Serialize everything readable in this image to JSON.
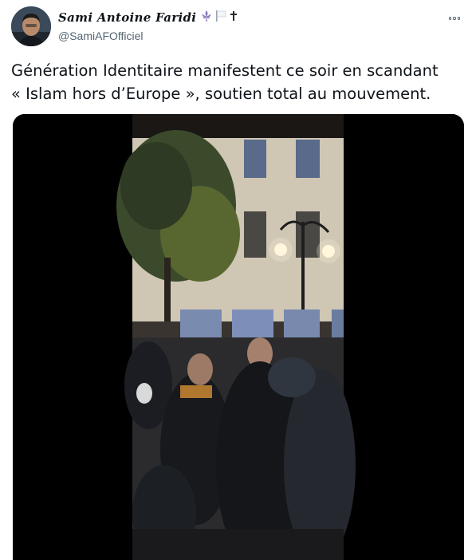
{
  "tweet": {
    "author": {
      "display_name": "Sami Antoine Faridi",
      "handle": "@SamiAFOfficiel",
      "name_emojis": [
        "fleur-de-lis-icon",
        "white-flag-icon",
        "latin-cross-icon"
      ]
    },
    "text_lines": [
      "Génération Identitaire manifestent ce soir en scandant",
      "« Islam hors d’Europe », soutien total au mouvement."
    ],
    "more_icon": "more-options-icon",
    "media": {
      "type": "video",
      "description_icon": "video-still"
    }
  },
  "colors": {
    "text": "#0f1419",
    "secondary_text": "#536471",
    "media_background": "#000000",
    "fleur_de_lis": "#8e7cc3"
  }
}
